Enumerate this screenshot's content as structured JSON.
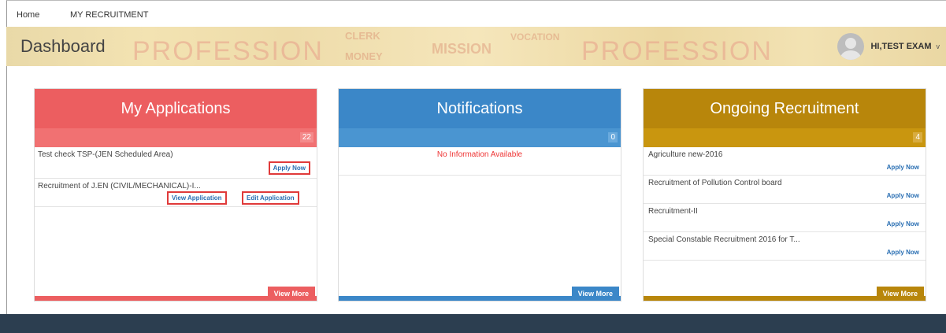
{
  "nav": {
    "home": "Home",
    "my_recruitment": "MY RECRUITMENT"
  },
  "banner": {
    "title": "Dashboard",
    "deco_words": [
      "PROFESSION",
      "CLERK",
      "MONEY",
      "MISSION",
      "VOCATION",
      "PROFESSION"
    ],
    "user_name": "HI,TEST EXAM",
    "caret": "v"
  },
  "panels": {
    "applications": {
      "title": "My Applications",
      "count": "22",
      "items": [
        {
          "text": "Test check TSP-(JEN Scheduled Area)",
          "apply": "Apply Now"
        },
        {
          "text": "Recruitment of J.EN (CIVIL/MECHANICAL)-I...",
          "view": "View Application",
          "edit": "Edit Application"
        }
      ],
      "more": "View More",
      "color": "#ec5e60"
    },
    "notifications": {
      "title": "Notifications",
      "count": "0",
      "empty": "No Information Available",
      "more": "View More",
      "color": "#3b87c8"
    },
    "recruitment": {
      "title": "Ongoing Recruitment",
      "count": "4",
      "items": [
        {
          "text": "Agriculture new-2016",
          "apply": "Apply Now"
        },
        {
          "text": "Recruitment of Pollution Control board",
          "apply": "Apply Now"
        },
        {
          "text": "Recruitment-II",
          "apply": "Apply Now"
        },
        {
          "text": "Special Constable Recruitment 2016 for T...",
          "apply": "Apply Now"
        }
      ],
      "more": "View More",
      "color": "#b8860b"
    }
  }
}
